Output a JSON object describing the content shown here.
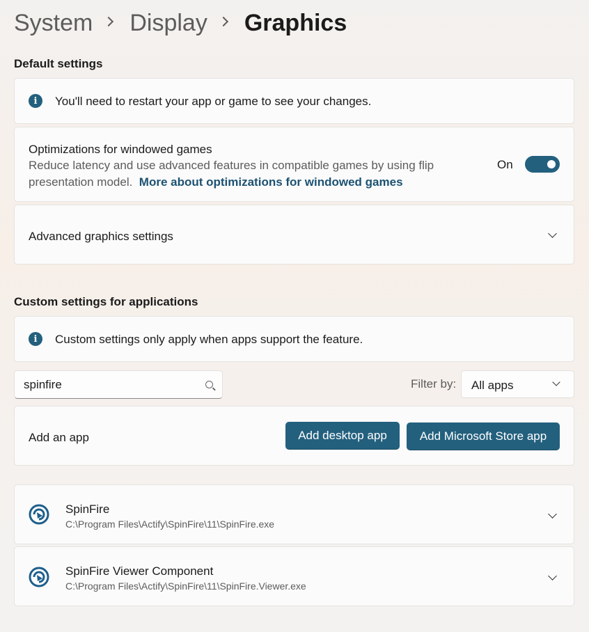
{
  "breadcrumb": {
    "items": [
      "System",
      "Display",
      "Graphics"
    ]
  },
  "default_settings": {
    "title": "Default settings",
    "info_text": "You'll need to restart your app or game to see your changes.",
    "windowed_games": {
      "title": "Optimizations for windowed games",
      "description": "Reduce latency and use advanced features in compatible games by using flip presentation model.",
      "link_text": "More about optimizations for windowed games",
      "toggle_label": "On",
      "toggle_on": true
    },
    "advanced": {
      "title": "Advanced graphics settings"
    }
  },
  "custom_settings": {
    "title": "Custom settings for applications",
    "info_text": "Custom settings only apply when apps support the feature.",
    "search": {
      "value": "spinfire"
    },
    "filter": {
      "label": "Filter by:",
      "value": "All apps"
    },
    "add_app": {
      "label": "Add an app",
      "desktop_button": "Add desktop app",
      "store_button": "Add Microsoft Store app"
    },
    "apps": [
      {
        "name": "SpinFire",
        "path": "C:\\Program Files\\Actify\\SpinFire\\11\\SpinFire.exe",
        "icon": "spinfire-icon"
      },
      {
        "name": "SpinFire Viewer Component",
        "path": "C:\\Program Files\\Actify\\SpinFire\\11\\SpinFire.Viewer.exe",
        "icon": "spinfire-icon"
      }
    ]
  },
  "colors": {
    "accent": "#23607e",
    "link": "#1c5272",
    "secondary_text": "#5c5c5c"
  }
}
